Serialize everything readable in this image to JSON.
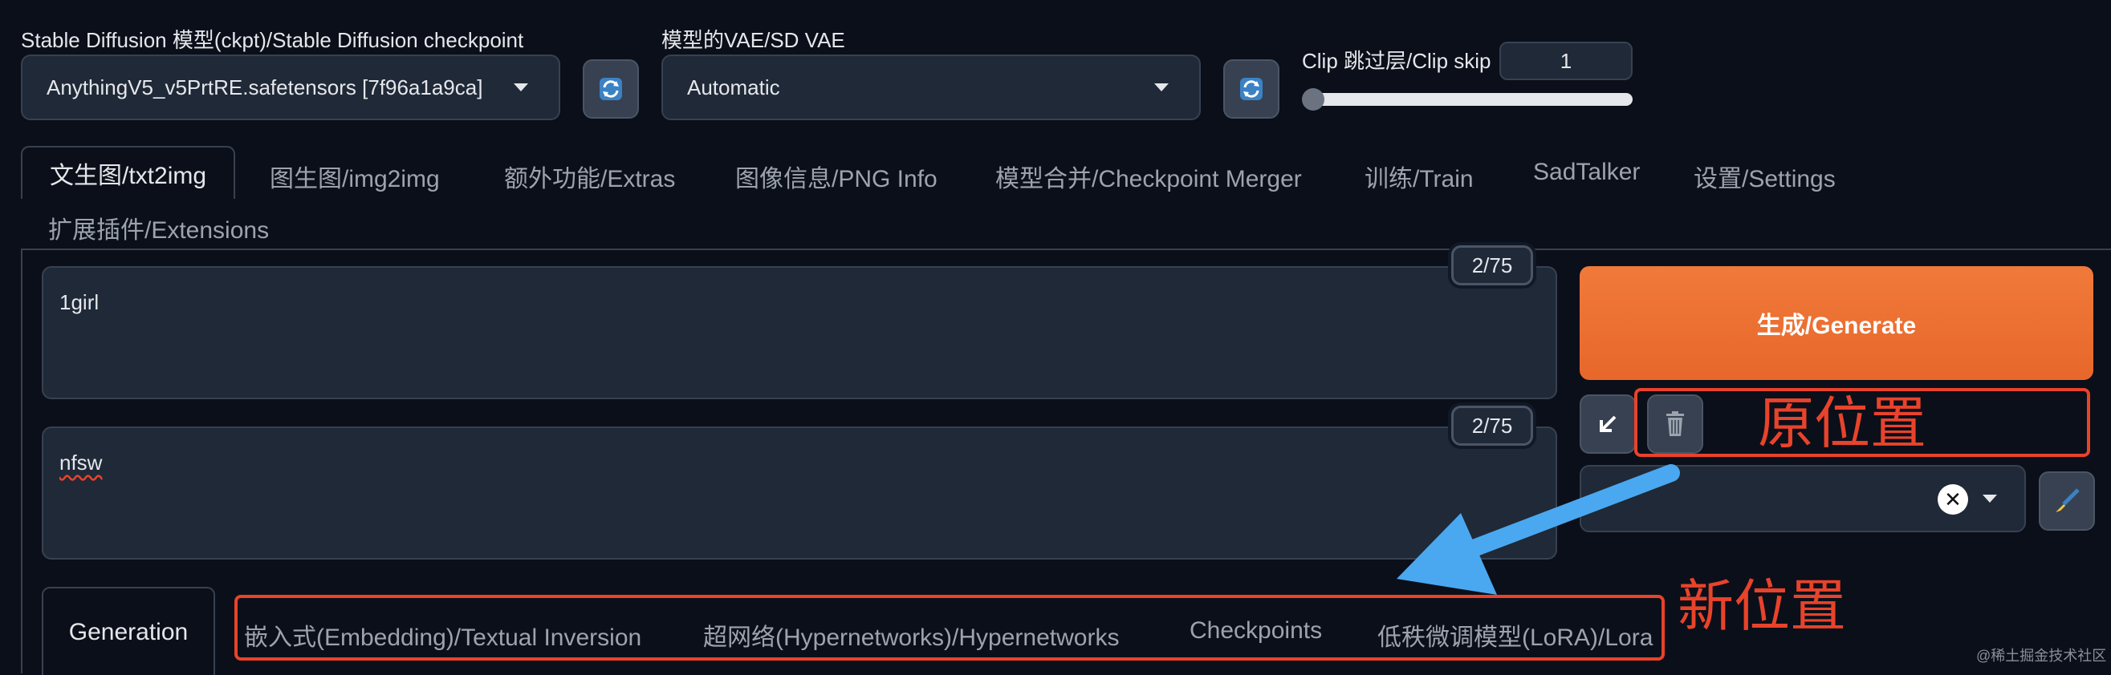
{
  "checkpoint": {
    "label": "Stable Diffusion 模型(ckpt)/Stable Diffusion checkpoint",
    "value": "AnythingV5_v5PrtRE.safetensors [7f96a1a9ca]"
  },
  "vae": {
    "label": "模型的VAE/SD VAE",
    "value": "Automatic"
  },
  "clip_skip": {
    "label": "Clip 跳过层/Clip skip",
    "value": "1",
    "slider_fraction": 0.0
  },
  "tabs": [
    {
      "label": "文生图/txt2img"
    },
    {
      "label": "图生图/img2img"
    },
    {
      "label": "额外功能/Extras"
    },
    {
      "label": "图像信息/PNG Info"
    },
    {
      "label": "模型合并/Checkpoint Merger"
    },
    {
      "label": "训练/Train"
    },
    {
      "label": "SadTalker"
    },
    {
      "label": "设置/Settings"
    },
    {
      "label": "扩展插件/Extensions"
    }
  ],
  "prompt": {
    "value": "1girl",
    "counter": "2/75"
  },
  "negative_prompt": {
    "value": "nfsw",
    "counter": "2/75"
  },
  "generate_button": "生成/Generate",
  "annotations": {
    "old_position": "原位置",
    "new_position": "新位置"
  },
  "subtabs": [
    {
      "label": "Generation"
    },
    {
      "label": "嵌入式(Embedding)/Textual Inversion"
    },
    {
      "label": "超网络(Hypernetworks)/Hypernetworks"
    },
    {
      "label": "Checkpoints"
    },
    {
      "label": "低秩微调模型(LoRA)/Lora"
    }
  ],
  "watermark": "@稀土掘金技术社区",
  "colors": {
    "accent": "#e8712b",
    "annotation": "#e8432b",
    "arrow": "#4aa8f0"
  }
}
